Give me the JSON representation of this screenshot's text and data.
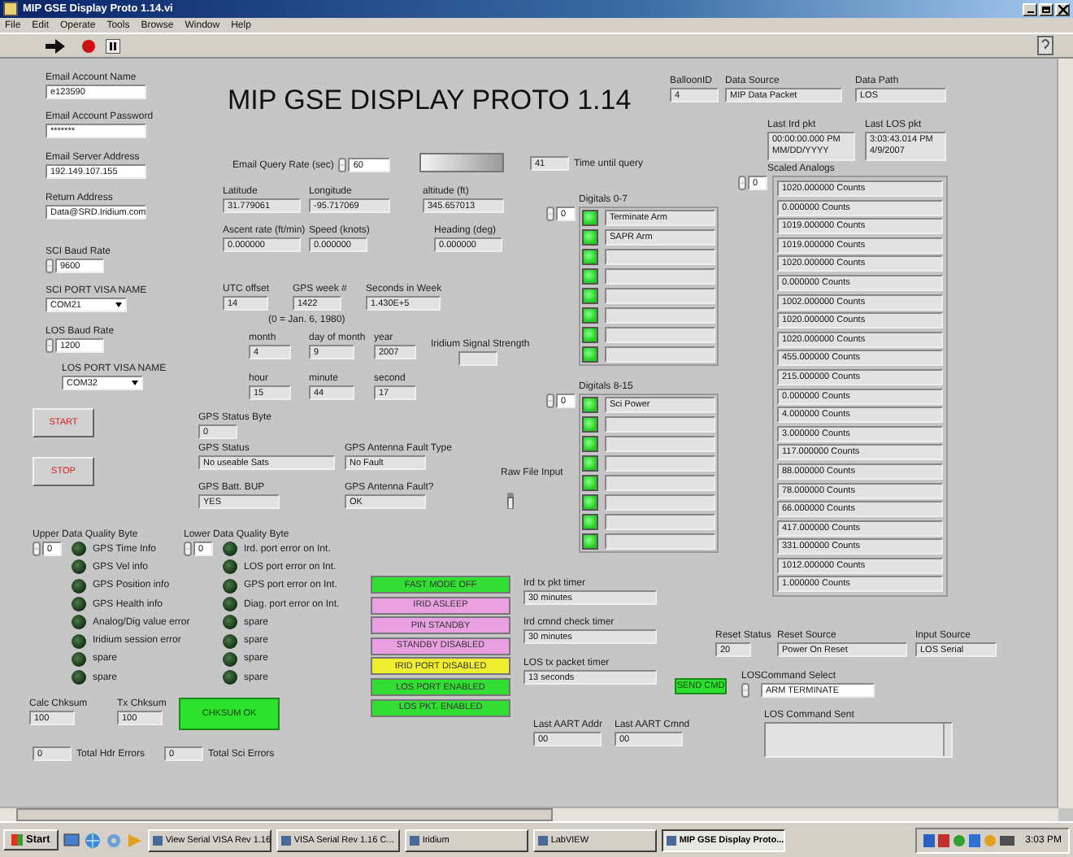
{
  "window": {
    "title": "MIP GSE Display Proto 1.14.vi"
  },
  "menu": [
    "File",
    "Edit",
    "Operate",
    "Tools",
    "Browse",
    "Window",
    "Help"
  ],
  "heading": "MIP GSE DISPLAY PROTO 1.14",
  "fields": [
    {
      "kind": "input",
      "label": "Email Account Name",
      "value": "e123590"
    },
    {
      "kind": "input",
      "label": "Email Account Password",
      "value": "*******"
    },
    {
      "kind": "input",
      "label": "Email Server Address",
      "value": "192.149.107.155"
    },
    {
      "kind": "input",
      "label": "Return Address",
      "value": "Data@SRD.Iridium.com"
    },
    {
      "kind": "spin",
      "label": "SCI Baud Rate",
      "value": "9600"
    },
    {
      "kind": "dropdown",
      "label": "SCI PORT VISA NAME",
      "value": "COM21"
    },
    {
      "kind": "spin",
      "label": "LOS Baud Rate",
      "value": "1200"
    },
    {
      "kind": "dropdown",
      "label": "LOS PORT VISA NAME",
      "value": "COM32"
    },
    {
      "kind": "spin",
      "label": "Email Query Rate (sec)",
      "value": "60"
    },
    {
      "kind": "text",
      "value": "41",
      "caption": "Time until query"
    },
    {
      "kind": "text",
      "label": "BalloonID",
      "value": "4"
    },
    {
      "kind": "text",
      "label": "Data Source",
      "value": "MIP Data Packet"
    },
    {
      "kind": "text",
      "label": "Data Path",
      "value": "LOS"
    },
    {
      "kind": "stamp",
      "label": "Last Ird pkt",
      "lines": [
        "00:00:00.000 PM",
        "MM/DD/YYYY"
      ]
    },
    {
      "kind": "stamp",
      "label": "Last LOS pkt",
      "lines": [
        "3:03:43.014 PM",
        "4/9/2007"
      ]
    },
    {
      "kind": "text",
      "label": "Latitude",
      "value": "31.779061"
    },
    {
      "kind": "text",
      "label": "Longitude",
      "value": "-95.717069"
    },
    {
      "kind": "text",
      "label": "altitude (ft)",
      "value": "345.657013"
    },
    {
      "kind": "text",
      "label": "Ascent rate (ft/min)",
      "value": "0.000000"
    },
    {
      "kind": "text",
      "label": "Speed (knots)",
      "value": "0.000000"
    },
    {
      "kind": "text",
      "label": "Heading (deg)",
      "value": "0.000000"
    },
    {
      "kind": "text",
      "label": "UTC offset",
      "value": "14"
    },
    {
      "kind": "text",
      "label": "GPS week #",
      "value": "1422"
    },
    {
      "kind": "text",
      "label": "Seconds in Week",
      "value": "1.430E+5"
    },
    {
      "kind": "text",
      "label": "month",
      "value": "4"
    },
    {
      "kind": "text",
      "label": "day of month",
      "value": "9"
    },
    {
      "kind": "text",
      "label": "year",
      "value": "2007"
    },
    {
      "kind": "blank",
      "label": "Iridium Signal Strength"
    },
    {
      "kind": "text",
      "label": "hour",
      "value": "15"
    },
    {
      "kind": "text",
      "label": "minute",
      "value": "44"
    },
    {
      "kind": "text",
      "label": "second",
      "value": "17"
    },
    {
      "kind": "text",
      "label": "GPS Status Byte",
      "value": "0"
    },
    {
      "kind": "text",
      "label": "GPS Status",
      "value": "No useable Sats"
    },
    {
      "kind": "text",
      "label": "GPS Antenna Fault Type",
      "value": "No Fault"
    },
    {
      "kind": "text",
      "label": "GPS Batt. BUP",
      "value": "YES"
    },
    {
      "kind": "text",
      "label": "GPS Antenna Fault?",
      "value": "OK"
    },
    {
      "kind": "text",
      "label": "Ird tx pkt timer",
      "value": "30 minutes"
    },
    {
      "kind": "text",
      "label": "Ird cmnd check timer",
      "value": "30 minutes"
    },
    {
      "kind": "text",
      "label": "LOS tx packet timer",
      "value": "13 seconds"
    },
    {
      "kind": "text",
      "label": "Last AART Addr",
      "value": "00"
    },
    {
      "kind": "text",
      "label": "Last AART Cmnd",
      "value": "00"
    },
    {
      "kind": "text",
      "label": "Reset Status",
      "value": "20"
    },
    {
      "kind": "text",
      "label": "Reset Source",
      "value": "Power On Reset"
    },
    {
      "kind": "text",
      "label": "Input Source",
      "value": "LOS Serial"
    },
    {
      "kind": "spin",
      "label": "LOSCommand Select",
      "value": "ARM TERMINATE"
    },
    {
      "kind": "text",
      "label": "Calc Chksum",
      "value": "100"
    },
    {
      "kind": "text",
      "label": "Tx Chksum",
      "value": "100"
    },
    {
      "kind": "textarea",
      "label": "LOS Command Sent"
    },
    {
      "kind": "text",
      "value": "0",
      "caption": "Total Hdr Errors"
    },
    {
      "kind": "text",
      "value": "0",
      "caption": "Total Sci Errors"
    }
  ],
  "date_note": "(0 = Jan. 6, 1980)",
  "raw_file_input": {
    "label": "Raw File Input",
    "on": false
  },
  "buttons": [
    {
      "kind": "push",
      "label": "START"
    },
    {
      "kind": "push",
      "label": "STOP"
    },
    {
      "kind": "indicator",
      "label": "CHKSUM OK"
    },
    {
      "kind": "indicator",
      "label": "SEND CMD"
    }
  ],
  "digitals": [
    {
      "title": "Digitals 0-7",
      "index": "0",
      "rows": [
        {
          "on": true,
          "text": "Terminate Arm"
        },
        {
          "on": true,
          "text": "SAPR Arm"
        },
        {
          "on": true
        },
        {
          "on": true
        },
        {
          "on": true
        },
        {
          "on": true
        },
        {
          "on": true
        },
        {
          "on": true
        }
      ]
    },
    {
      "title": "Digitals 8-15",
      "index": "0",
      "rows": [
        {
          "on": true,
          "text": "Sci Power"
        },
        {
          "on": true
        },
        {
          "on": true
        },
        {
          "on": true
        },
        {
          "on": true
        },
        {
          "on": true
        },
        {
          "on": true
        },
        {
          "on": true
        }
      ]
    }
  ],
  "quality": [
    {
      "title": "Upper Data Quality Byte",
      "index": "0",
      "rows": [
        {
          "on": false,
          "label": "GPS Time Info"
        },
        {
          "on": false,
          "label": "GPS Vel info"
        },
        {
          "on": false,
          "label": "GPS Position info"
        },
        {
          "on": false,
          "label": "GPS Health info"
        },
        {
          "on": false,
          "label": "Analog/Dig value error"
        },
        {
          "on": false,
          "label": "Iridium session error"
        },
        {
          "on": false,
          "label": "spare"
        },
        {
          "on": false,
          "label": "spare"
        }
      ]
    },
    {
      "title": "Lower Data Quality Byte",
      "index": "0",
      "rows": [
        {
          "on": false,
          "label": "Ird. port error on Int."
        },
        {
          "on": false,
          "label": "LOS port error on Int."
        },
        {
          "on": false,
          "label": "GPS port error on Int."
        },
        {
          "on": false,
          "label": "Diag. port error on Int."
        },
        {
          "on": false,
          "label": "spare"
        },
        {
          "on": false,
          "label": "spare"
        },
        {
          "on": false,
          "label": "spare"
        },
        {
          "on": false,
          "label": "spare"
        }
      ]
    }
  ],
  "analogs": {
    "title": "Scaled Analogs",
    "index": "0",
    "values": [
      "1020.000000 Counts",
      "0.000000 Counts",
      "1019.000000 Counts",
      "1019.000000 Counts",
      "1020.000000 Counts",
      "0.000000 Counts",
      "1002.000000 Counts",
      "1020.000000 Counts",
      "1020.000000 Counts",
      "455.000000 Counts",
      "215.000000 Counts",
      "0.000000 Counts",
      "4.000000 Counts",
      "3.000000 Counts",
      "117.000000 Counts",
      "88.000000 Counts",
      "78.000000 Counts",
      "66.000000 Counts",
      "417.000000 Counts",
      "331.000000 Counts",
      "1012.000000 Counts",
      "1.000000 Counts"
    ]
  },
  "mode_buttons": [
    {
      "label": "FAST MODE OFF",
      "color": "#33dd33"
    },
    {
      "label": "IRID ASLEEP",
      "color": "#e8a0e0"
    },
    {
      "label": "PIN STANDBY",
      "color": "#e8a0e0"
    },
    {
      "label": "STANDBY DISABLED",
      "color": "#e8a0e0"
    },
    {
      "label": "IRID PORT DISABLED",
      "color": "#f0ee30"
    },
    {
      "label": "LOS PORT ENABLED",
      "color": "#33dd33"
    },
    {
      "label": "LOS PKT. ENABLED",
      "color": "#33dd33"
    }
  ],
  "taskbar": {
    "start": "Start",
    "items": [
      {
        "label": "View Serial VISA Rev 1.16",
        "selected": false
      },
      {
        "label": "VISA Serial Rev 1.16  C...",
        "selected": false
      },
      {
        "label": "Iridium",
        "selected": false
      },
      {
        "label": "LabVIEW",
        "selected": false
      },
      {
        "label": "MIP GSE Display Proto...",
        "selected": true
      }
    ],
    "clock": "3:03 PM"
  }
}
